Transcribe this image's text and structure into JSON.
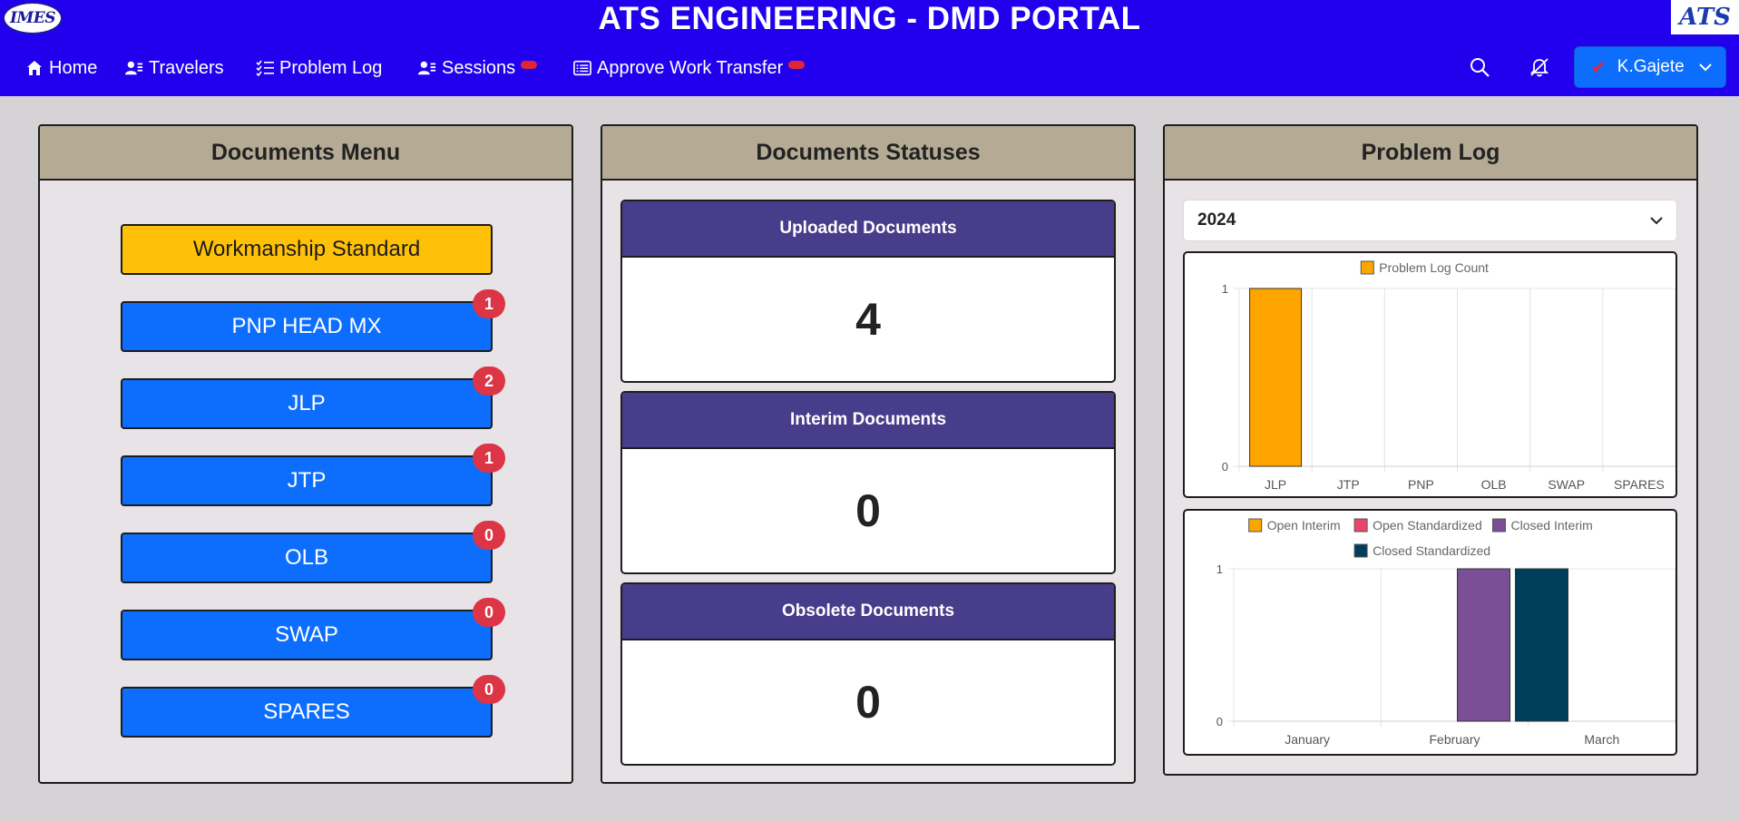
{
  "header": {
    "title": "ATS ENGINEERING - DMD PORTAL",
    "logo_left_text": "IMES",
    "logo_right_text": "ATS",
    "nav": [
      {
        "label": "Home",
        "icon": "home-icon"
      },
      {
        "label": "Travelers",
        "icon": "user-list-icon"
      },
      {
        "label": "Problem Log",
        "icon": "checklist-icon"
      },
      {
        "label": "Sessions",
        "icon": "user-list-icon"
      },
      {
        "label": "Approve Work Transfer",
        "icon": "document-list-icon"
      }
    ],
    "user": {
      "name": "K.Gajete",
      "icon": "check-icon"
    },
    "colors": {
      "header_bg": "#2200ee",
      "notify_dot": "#e0243a"
    }
  },
  "documents_menu": {
    "title": "Documents Menu",
    "items": [
      {
        "label": "Workmanship Standard",
        "badge": null
      },
      {
        "label": "PNP HEAD MX",
        "badge": "1"
      },
      {
        "label": "JLP",
        "badge": "2"
      },
      {
        "label": "JTP",
        "badge": "1"
      },
      {
        "label": "OLB",
        "badge": "0"
      },
      {
        "label": "SWAP",
        "badge": "0"
      },
      {
        "label": "SPARES",
        "badge": "0"
      }
    ]
  },
  "documents_statuses": {
    "title": "Documents Statuses",
    "items": [
      {
        "label": "Uploaded Documents",
        "value": "4"
      },
      {
        "label": "Interim Documents",
        "value": "0"
      },
      {
        "label": "Obsolete Documents",
        "value": "0"
      }
    ]
  },
  "problem_log": {
    "title": "Problem Log",
    "year": "2024"
  },
  "chart_data": [
    {
      "type": "bar",
      "categories": [
        "JLP",
        "JTP",
        "PNP",
        "OLB",
        "SWAP",
        "SPARES"
      ],
      "series": [
        {
          "name": "Problem Log Count",
          "values": [
            1,
            0,
            0,
            0,
            0,
            0
          ],
          "color": "#ffa500"
        }
      ],
      "ylim": [
        0,
        1
      ],
      "yticks": [
        "0",
        "1"
      ],
      "legend": "top",
      "grid": true
    },
    {
      "type": "bar",
      "categories": [
        "January",
        "February",
        "March"
      ],
      "series": [
        {
          "name": "Open Interim",
          "values": [
            0,
            0,
            0
          ],
          "color": "#ffa500"
        },
        {
          "name": "Open Standardized",
          "values": [
            0,
            0,
            0
          ],
          "color": "#e8476b"
        },
        {
          "name": "Closed Interim",
          "values": [
            0,
            1,
            0
          ],
          "color": "#7b4f96"
        },
        {
          "name": "Closed Standardized",
          "values": [
            0,
            1,
            0
          ],
          "color": "#003f5c"
        }
      ],
      "ylim": [
        0,
        1
      ],
      "yticks": [
        "0",
        "1"
      ],
      "legend": "top",
      "grid": true
    }
  ]
}
